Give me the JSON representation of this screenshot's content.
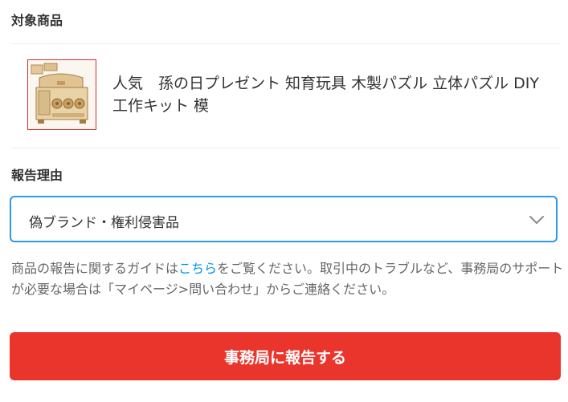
{
  "section_target": {
    "title": "対象商品"
  },
  "product": {
    "name": "人気　孫の日プレゼント 知育玩具 木製パズル 立体パズル DIY 工作キット 模",
    "thumbnail_icon": "wooden-puzzle-box-image"
  },
  "section_reason": {
    "title": "報告理由"
  },
  "reason_select": {
    "selected": "偽ブランド・権利侵害品",
    "icon": "chevron-down-icon"
  },
  "guide": {
    "text_before": "商品の報告に関するガイドは",
    "link": "こちら",
    "text_after": "をご覧ください。取引中のトラブルなど、事務局のサポートが必要な場合は「マイページ>問い合わせ」からご連絡ください。"
  },
  "submit": {
    "label": "事務局に報告する"
  },
  "colors": {
    "accent_blue": "#2b9be6",
    "link_blue": "#0095ee",
    "button_red": "#ea352d",
    "thumb_border": "#cc3333"
  }
}
